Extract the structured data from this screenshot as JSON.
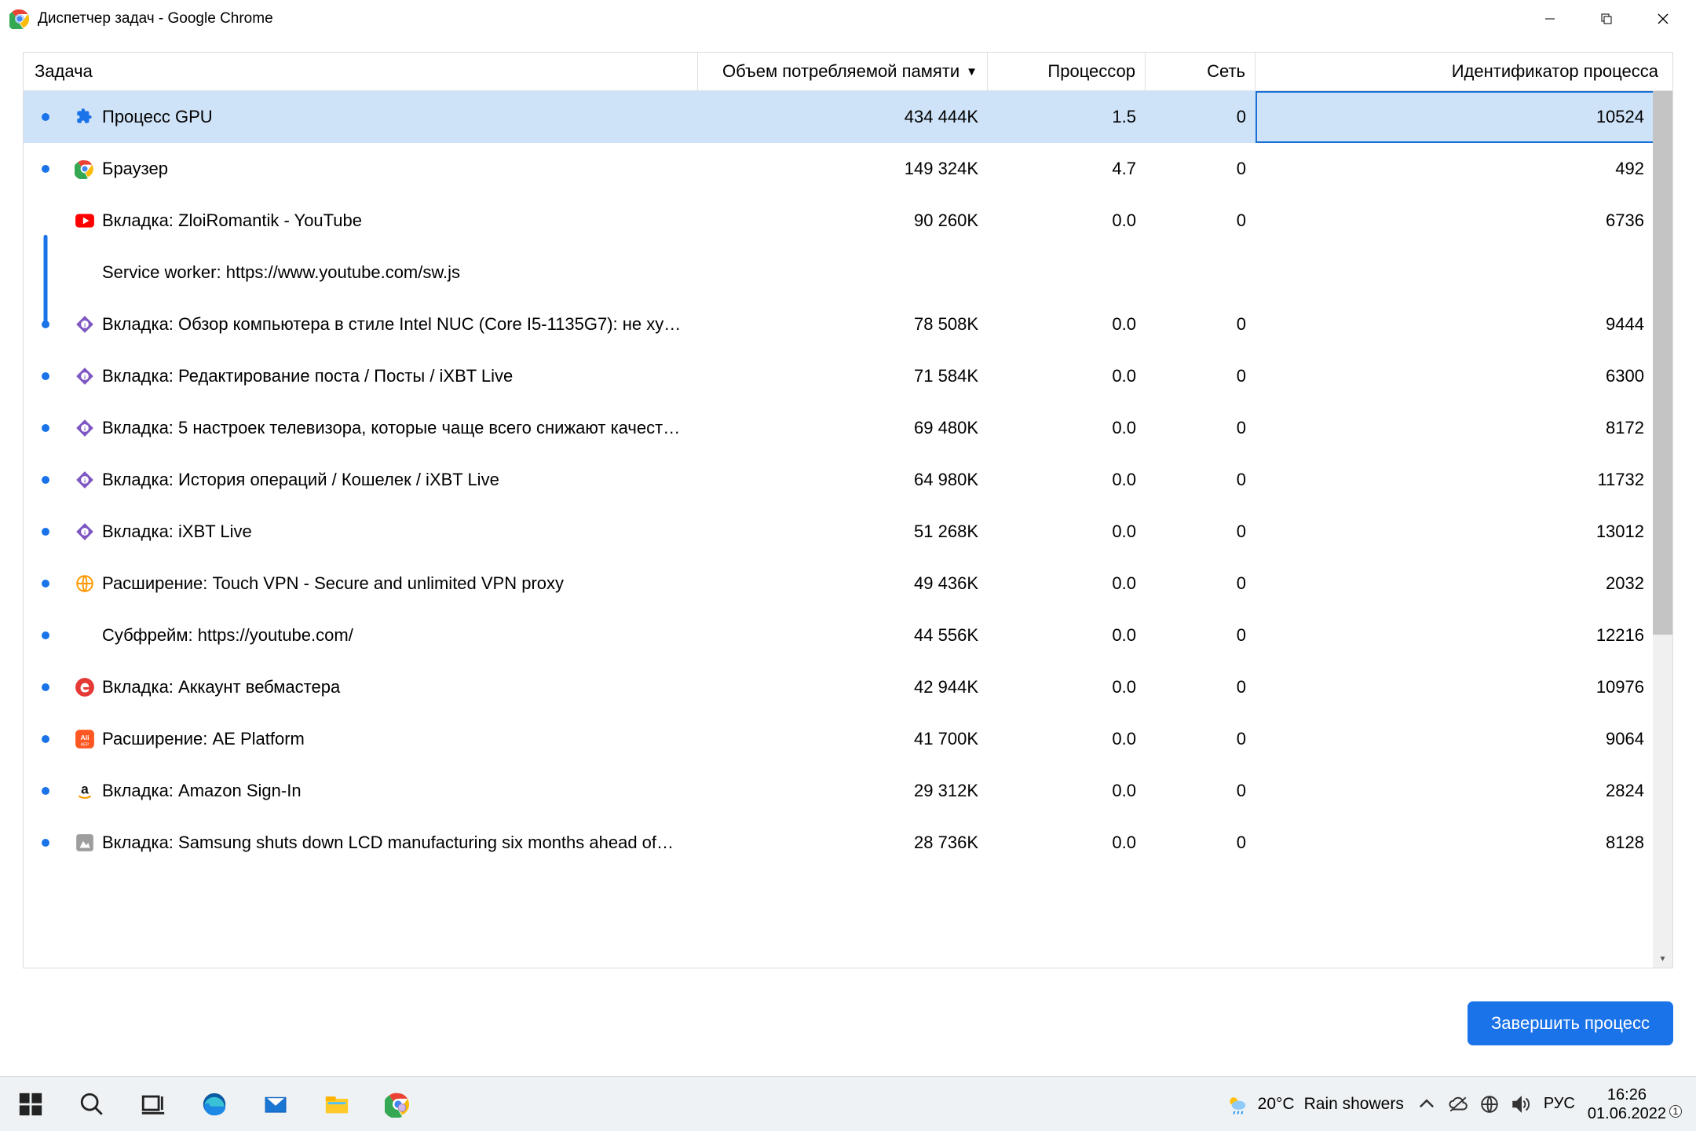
{
  "window": {
    "title": "Диспетчер задач - Google Chrome"
  },
  "columns": {
    "task": "Задача",
    "memory": "Объем потребляемой памяти",
    "cpu": "Процессор",
    "net": "Сеть",
    "pid": "Идентификатор процесса",
    "sort_indicator": "▼"
  },
  "rows": [
    {
      "icon": "puzzle",
      "name": "Процесс GPU",
      "mem": "434 444K",
      "cpu": "1.5",
      "net": "0",
      "pid": "10524",
      "selected": true
    },
    {
      "icon": "chrome",
      "name": "Браузер",
      "mem": "149 324K",
      "cpu": "4.7",
      "net": "0",
      "pid": "492"
    },
    {
      "icon": "youtube",
      "name": "Вкладка: ZloiRomantik - YouTube",
      "mem": "90 260K",
      "cpu": "0.0",
      "net": "0",
      "pid": "6736",
      "group": "lead"
    },
    {
      "icon": "",
      "name": "Service worker: https://www.youtube.com/sw.js",
      "mem": "",
      "cpu": "",
      "net": "",
      "pid": "",
      "group": "sub"
    },
    {
      "icon": "ixbt",
      "name": "Вкладка: Обзор компьютера в стиле Intel NUC (Core I5-1135G7): не ху…",
      "mem": "78 508K",
      "cpu": "0.0",
      "net": "0",
      "pid": "9444"
    },
    {
      "icon": "ixbt",
      "name": "Вкладка: Редактирование поста / Посты / iXBT Live",
      "mem": "71 584K",
      "cpu": "0.0",
      "net": "0",
      "pid": "6300"
    },
    {
      "icon": "ixbt",
      "name": "Вкладка: 5 настроек телевизора, которые чаще всего снижают качест…",
      "mem": "69 480K",
      "cpu": "0.0",
      "net": "0",
      "pid": "8172"
    },
    {
      "icon": "ixbt",
      "name": "Вкладка: История операций / Кошелек / iXBT Live",
      "mem": "64 980K",
      "cpu": "0.0",
      "net": "0",
      "pid": "11732"
    },
    {
      "icon": "ixbt",
      "name": "Вкладка: iXBT Live",
      "mem": "51 268K",
      "cpu": "0.0",
      "net": "0",
      "pid": "13012"
    },
    {
      "icon": "globe",
      "name": "Расширение: Touch VPN - Secure and unlimited VPN proxy",
      "mem": "49 436K",
      "cpu": "0.0",
      "net": "0",
      "pid": "2032"
    },
    {
      "icon": "",
      "name": "Субфрейм: https://youtube.com/",
      "mem": "44 556K",
      "cpu": "0.0",
      "net": "0",
      "pid": "12216"
    },
    {
      "icon": "red-e",
      "name": "Вкладка: Аккаунт вебмастера",
      "mem": "42 944K",
      "cpu": "0.0",
      "net": "0",
      "pid": "10976"
    },
    {
      "icon": "ae",
      "name": "Расширение: AE Platform",
      "mem": "41 700K",
      "cpu": "0.0",
      "net": "0",
      "pid": "9064"
    },
    {
      "icon": "amazon",
      "name": "Вкладка: Amazon Sign-In",
      "mem": "29 312K",
      "cpu": "0.0",
      "net": "0",
      "pid": "2824"
    },
    {
      "icon": "generic",
      "name": "Вкладка: Samsung shuts down LCD manufacturing six months ahead of…",
      "mem": "28 736K",
      "cpu": "0.0",
      "net": "0",
      "pid": "8128"
    }
  ],
  "buttons": {
    "end_process": "Завершить процесс"
  },
  "taskbar": {
    "weather_temp": "20°C",
    "weather_text": "Rain showers",
    "lang": "РУС",
    "time": "16:26",
    "date": "01.06.2022",
    "notif_count": "1"
  }
}
